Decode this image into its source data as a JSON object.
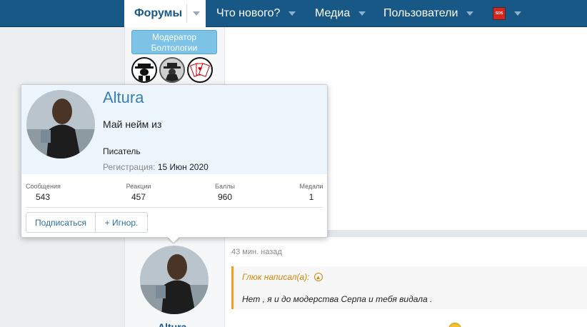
{
  "nav": {
    "tabs": [
      {
        "label": "Форумы"
      },
      {
        "label": "Что нового?"
      },
      {
        "label": "Медиа"
      },
      {
        "label": "Пользователи"
      }
    ],
    "sos_icon": "sos-icon"
  },
  "sidebar": {
    "badge_line1": "Модератор",
    "badge_line2": "Болтологии",
    "awards": [
      "mafia-boss-icon",
      "detective-icon",
      "playing-cards-icon"
    ]
  },
  "popup": {
    "name": "Altura",
    "status": "Май нейм из",
    "user_title": "Писатель",
    "reg_label": "Регистрация:",
    "reg_date": "15 Июн 2020",
    "stats": [
      {
        "label": "Сообщения",
        "value": "543"
      },
      {
        "label": "Реакции",
        "value": "457"
      },
      {
        "label": "Баллы",
        "value": "960"
      },
      {
        "label": "Медали",
        "value": "1"
      }
    ],
    "follow_label": "Подписаться",
    "ignore_label": "+ Игнор."
  },
  "post": {
    "time": "43 мин. назад",
    "quote_author": "Глюк написал(а):",
    "quote_text": "Нет , я и до модерства Серпа и тебя видала .",
    "author_name": "Altura"
  },
  "colors": {
    "nav_bg": "#185886",
    "accent": "#3a7fb4",
    "quote_border": "#f0a020",
    "badge_bg": "#7cc3e6"
  }
}
